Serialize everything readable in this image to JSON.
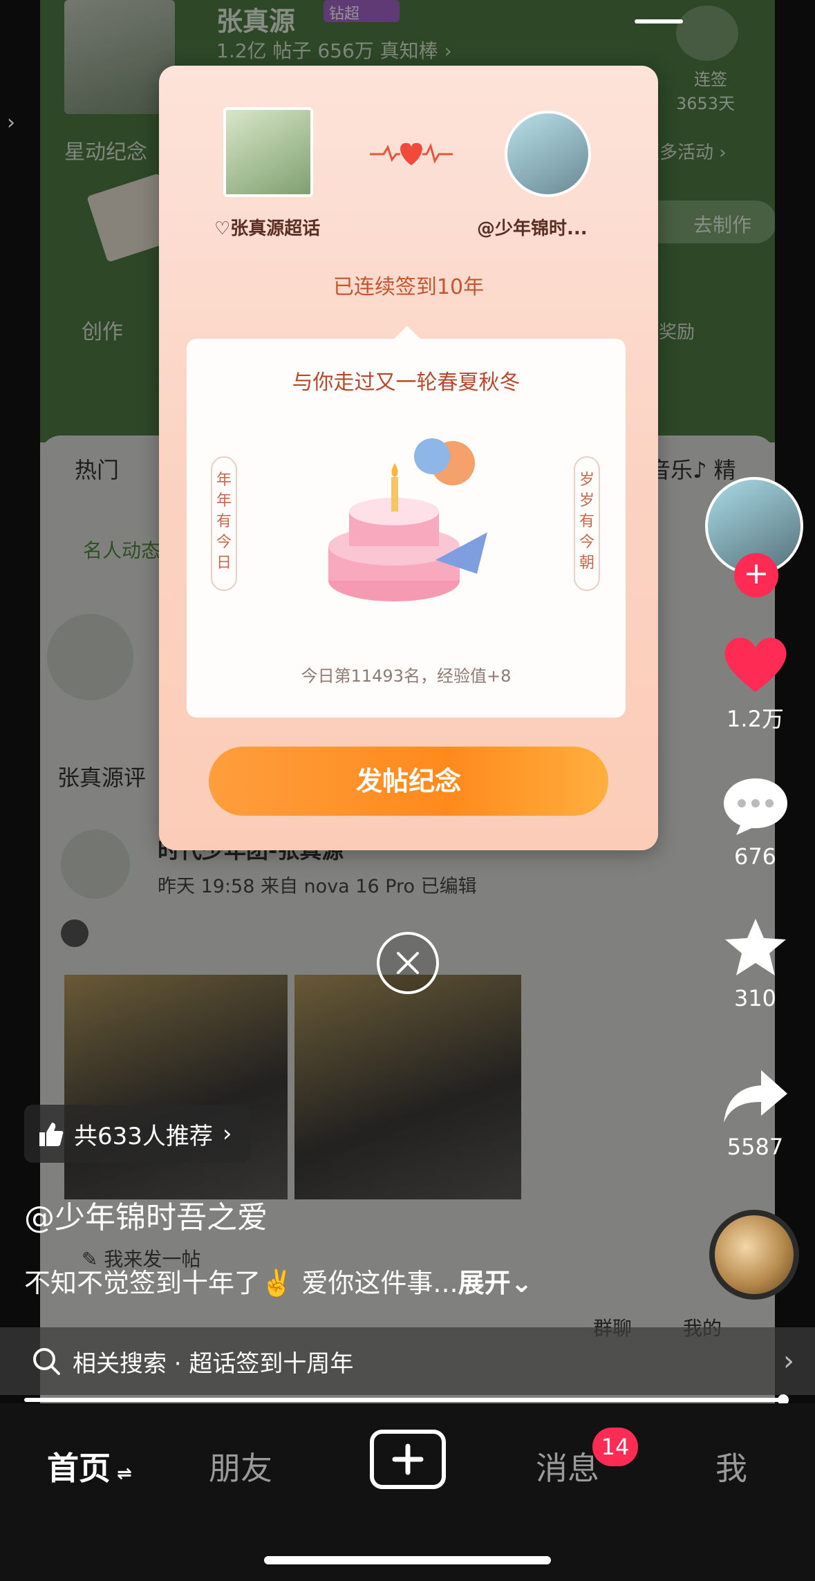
{
  "background_post": {
    "header_name": "张真源",
    "header_tag": "钻超",
    "header_stats": "1.2亿 帖子   656万 真知棒 ›",
    "sign_label": "连签",
    "sign_days": "3653天",
    "row1_left": "星动纪念",
    "row1_right": "更多活动 ›",
    "make_button": "去制作",
    "row2_left": "创作",
    "row2_right": "奖励",
    "tabs_left": "热门",
    "tabs_right": "音乐♪  精",
    "famous": "名人动态",
    "zhang_title": "张真源评",
    "post_author": "时代少年团-张真源",
    "post_meta": "昨天 19:58  来自 nova 16 Pro  已编辑",
    "bottom_row": "✎ 我来发一帖",
    "group_chat": "群聊",
    "mine": "我的"
  },
  "popup": {
    "left_label": "♡张真源超话",
    "right_label": "@少年锦时...",
    "years_text": "已连续签到10年",
    "inner_title": "与你走过又一轮春夏秋冬",
    "scroll_left": "年年有今日",
    "scroll_right": "岁岁有今朝",
    "rank_text": "今日第11493名，经验值+8",
    "post_button": "发帖纪念"
  },
  "right_rail": {
    "likes": "1.2万",
    "comments": "676",
    "favorites": "310",
    "shares": "5587"
  },
  "recommend_text": "共633人推荐",
  "author": "@少年锦时吾之爱",
  "caption_text": "不知不觉签到十年了✌️ 爱你这件事...",
  "caption_more": "展开⌄",
  "related_search": "相关搜索 · 超话签到十周年",
  "tabbar": {
    "home": "首页",
    "friends": "朋友",
    "messages": "消息",
    "messages_badge": "14",
    "me": "我"
  },
  "colors": {
    "accent_red": "#fe2c55",
    "orange_button": "#ff8a1c"
  }
}
